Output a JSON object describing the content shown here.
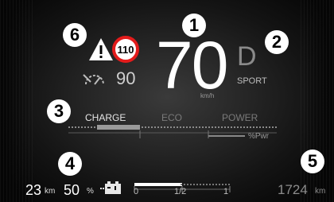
{
  "callouts": [
    "1",
    "2",
    "3",
    "4",
    "5",
    "6"
  ],
  "speed": {
    "value": "70",
    "unit": "km/h"
  },
  "gear": {
    "value": "D",
    "mode": "SPORT"
  },
  "speed_limit": {
    "value": "110"
  },
  "cruise": {
    "set_speed": "90"
  },
  "drive_modes": [
    "CHARGE",
    "ECO",
    "POWER"
  ],
  "power_meter": {
    "unit": "%Pwr",
    "active_mode": "CHARGE"
  },
  "range": {
    "value": "23",
    "unit": "km"
  },
  "battery": {
    "value": "50",
    "unit": "%"
  },
  "fuel_gauge": {
    "labels": [
      "0",
      "1/2",
      "1"
    ],
    "level": 0.5
  },
  "odometer": {
    "value": "1724",
    "unit": "km"
  },
  "colors": {
    "limit_ring": "#e31b1b",
    "background": "#262626",
    "dim_text": "#8a8a8a"
  }
}
